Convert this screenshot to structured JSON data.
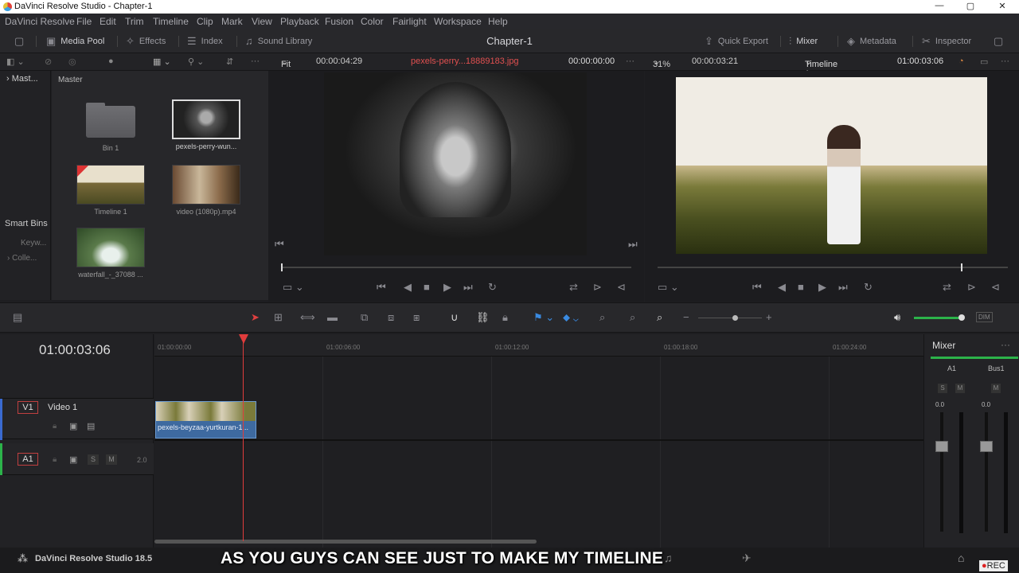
{
  "window": {
    "title": "DaVinci Resolve Studio - Chapter-1",
    "min": "—",
    "max": "▢",
    "close": "✕"
  },
  "menu": [
    "DaVinci Resolve",
    "File",
    "Edit",
    "Trim",
    "Timeline",
    "Clip",
    "Mark",
    "View",
    "Playback",
    "Fusion",
    "Color",
    "Fairlight",
    "Workspace",
    "Help"
  ],
  "toolbar": {
    "media_pool": "Media Pool",
    "effects": "Effects",
    "index": "Index",
    "sound_library": "Sound Library",
    "project_title": "Chapter-1",
    "quick_export": "Quick Export",
    "mixer": "Mixer",
    "metadata": "Metadata",
    "inspector": "Inspector"
  },
  "viewer_bar": {
    "fit": "Fit",
    "src_duration": "00:00:04:29",
    "src_clip": "pexels-perry...18889183.jpg",
    "src_tc": "00:00:00:00",
    "zoom": "31%",
    "rec_duration": "00:00:03:21",
    "timeline_name": "Timeline 1",
    "rec_tc": "01:00:03:06"
  },
  "bins": {
    "master_short": "Mast...",
    "master": "Master",
    "smart_bins": "Smart Bins",
    "keywords": "Keyw...",
    "collections": "Colle..."
  },
  "clips": [
    {
      "label": "Bin 1"
    },
    {
      "label": "pexels-perry-wun..."
    },
    {
      "label": "Timeline 1"
    },
    {
      "label": "video (1080p).mp4"
    },
    {
      "label": "waterfall_-_37088 ..."
    }
  ],
  "timeline": {
    "timecode": "01:00:03:06",
    "ruler": [
      "01:00:00:00",
      "01:00:06:00",
      "01:00:12:00",
      "01:00:18:00",
      "01:00:24:00"
    ],
    "v1_id": "V1",
    "v1_name": "Video 1",
    "a1_id": "A1",
    "a1_level": "2.0",
    "solo": "S",
    "mute": "M",
    "clip_name": "pexels-beyzaa-yurtkuran-1..."
  },
  "mixer": {
    "title": "Mixer",
    "ch1": "A1",
    "ch2": "Bus1",
    "s": "S",
    "m": "M",
    "m2": "M",
    "v1": "0.0",
    "v2": "0.0",
    "dim": "DIM"
  },
  "bottom": {
    "app": "DaVinci Resolve Studio 18.5",
    "rec": "REC"
  },
  "subtitle": "AS YOU GUYS CAN SEE JUST TO MAKE MY TIMELINE"
}
